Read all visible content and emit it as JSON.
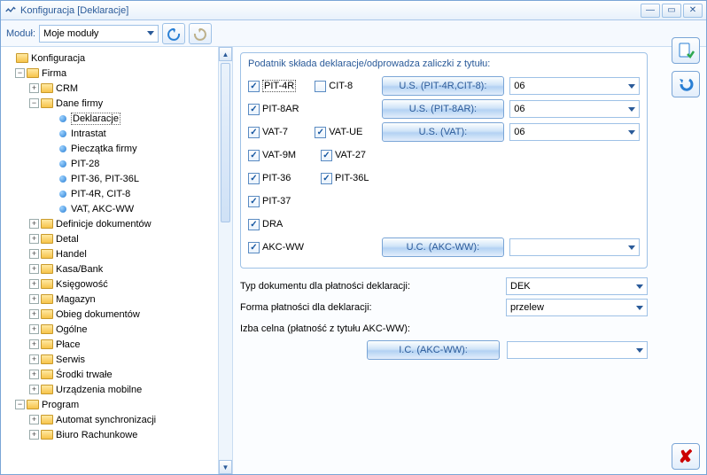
{
  "titlebar": {
    "title": "Konfiguracja [Deklaracje]"
  },
  "toolbar": {
    "module_label": "Moduł:",
    "module_value": "Moje moduły"
  },
  "tree": {
    "root": "Konfiguracja",
    "firma": "Firma",
    "crm": "CRM",
    "dane_firmy": "Dane firmy",
    "deklaracje": "Deklaracje",
    "intrastat": "Intrastat",
    "pieczatka": "Pieczątka firmy",
    "pit28": "PIT-28",
    "pit36_36l": "PIT-36, PIT-36L",
    "pit4r_cit8": "PIT-4R, CIT-8",
    "vat_akc": "VAT, AKC-WW",
    "def_dok": "Definicje dokumentów",
    "detal": "Detal",
    "handel": "Handel",
    "kasa_bank": "Kasa/Bank",
    "ksiegowosc": "Księgowość",
    "magazyn": "Magazyn",
    "obieg": "Obieg dokumentów",
    "ogolne": "Ogólne",
    "place": "Płace",
    "serwis": "Serwis",
    "srodki": "Środki trwałe",
    "urzadzenia": "Urządzenia mobilne",
    "program": "Program",
    "autosync": "Automat synchronizacji",
    "biuro": "Biuro Rachunkowe"
  },
  "panel": {
    "title": "Podatnik składa deklaracje/odprowadza zaliczki z tytułu:",
    "pit4r": "PIT-4R",
    "cit8": "CIT-8",
    "usbtn1": "U.S. (PIT-4R,CIT-8):",
    "pit8ar": "PIT-8AR",
    "usbtn2": "U.S. (PIT-8AR):",
    "vat7": "VAT-7",
    "vatue": "VAT-UE",
    "usbtn3": "U.S. (VAT):",
    "vat9m": "VAT-9M",
    "vat27": "VAT-27",
    "pit36": "PIT-36",
    "pit36l": "PIT-36L",
    "pit37": "PIT-37",
    "dra": "DRA",
    "akcww": "AKC-WW",
    "ucbtn": "U.C. (AKC-WW):",
    "val06": "06",
    "val_empty": ""
  },
  "form": {
    "typ_dok": "Typ dokumentu dla płatności deklaracji:",
    "typ_val": "DEK",
    "forma": "Forma płatności dla deklaracji:",
    "forma_val": "przelew",
    "izba": "Izba celna (płatność z tytułu AKC-WW):",
    "icbtn": "I.C. (AKC-WW):",
    "ic_val": ""
  }
}
